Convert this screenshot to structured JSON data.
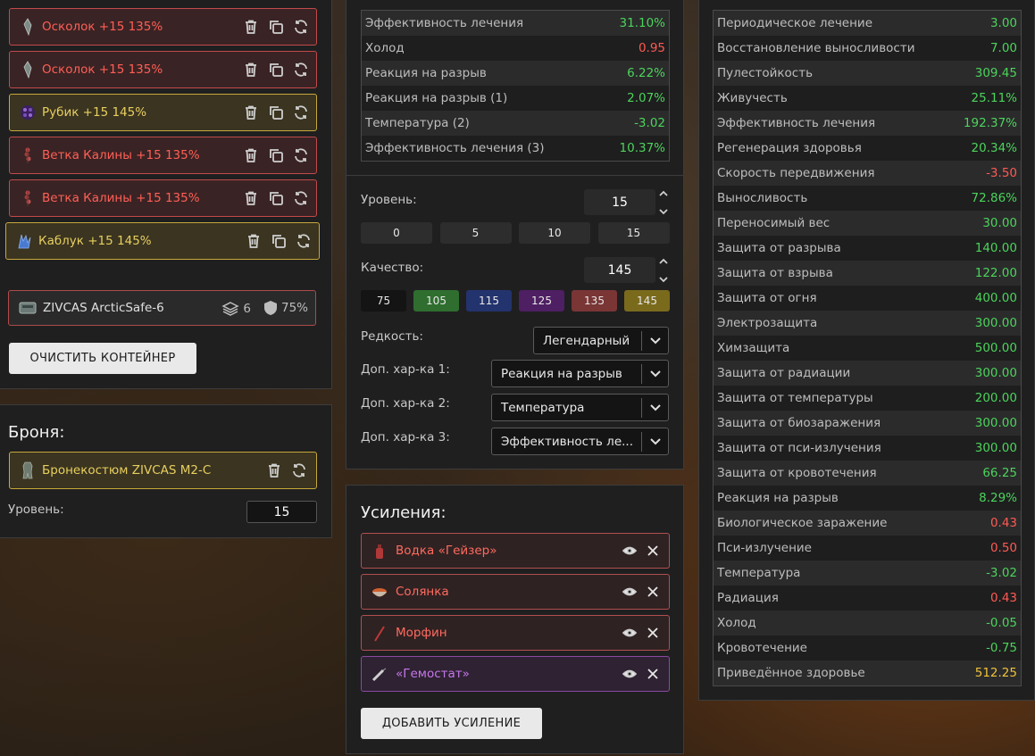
{
  "left": {
    "slots": [
      {
        "name": "Осколок +15 135%",
        "rarity": "red"
      },
      {
        "name": "Осколок +15 135%",
        "rarity": "red"
      },
      {
        "name": "Рубик +15 145%",
        "rarity": "gold"
      },
      {
        "name": "Ветка Калины +15 135%",
        "rarity": "red"
      },
      {
        "name": "Ветка Калины +15 135%",
        "rarity": "red"
      },
      {
        "name": "Каблук +15 145%",
        "rarity": "gold"
      }
    ],
    "container": {
      "name": "ZIVCAS ArcticSafe-6",
      "slots": "6",
      "protection": "75%"
    },
    "clear_button": "ОЧИСТИТЬ КОНТЕЙНЕР"
  },
  "armor": {
    "title": "Броня:",
    "item": "Бронекостюм ZIVCAS M2-C",
    "level_label": "Уровень:",
    "level_value": "15"
  },
  "artifact_stats": [
    {
      "label": "Эффективность лечения",
      "value": "31.10%",
      "tone": "pos"
    },
    {
      "label": "Холод",
      "value": "0.95",
      "tone": "neg"
    },
    {
      "label": "Реакция на разрыв",
      "value": "6.22%",
      "tone": "pos"
    },
    {
      "label": "Реакция на разрыв (1)",
      "value": "2.07%",
      "tone": "pos"
    },
    {
      "label": "Температура (2)",
      "value": "-3.02",
      "tone": "pos"
    },
    {
      "label": "Эффективность лечения (3)",
      "value": "10.37%",
      "tone": "pos"
    }
  ],
  "editor": {
    "level_label": "Уровень:",
    "level_value": "15",
    "level_presets": [
      "0",
      "5",
      "10",
      "15"
    ],
    "quality_label": "Качество:",
    "quality_value": "145",
    "quality_presets": [
      {
        "v": "75",
        "c": "#141414"
      },
      {
        "v": "105",
        "c": "#2f6e2f"
      },
      {
        "v": "115",
        "c": "#23336e"
      },
      {
        "v": "125",
        "c": "#4e1f62"
      },
      {
        "v": "135",
        "c": "#7a3535"
      },
      {
        "v": "145",
        "c": "#7a6a1c"
      }
    ],
    "rarity_label": "Редкость:",
    "rarity_value": "Легендарный",
    "extra1_label": "Доп. хар-ка 1:",
    "extra1_value": "Реакция на разрыв",
    "extra2_label": "Доп. хар-ка 2:",
    "extra2_value": "Температура",
    "extra3_label": "Доп. хар-ка 3:",
    "extra3_value": "Эффективность ле..."
  },
  "boosts": {
    "title": "Усиления:",
    "items": [
      {
        "name": "Водка «Гейзер»",
        "tone": "red"
      },
      {
        "name": "Солянка",
        "tone": "red"
      },
      {
        "name": "Морфин",
        "tone": "red"
      },
      {
        "name": "«Гемостат»",
        "tone": "violet"
      }
    ],
    "add_button": "ДОБАВИТЬ УСИЛЕНИЕ"
  },
  "summary": [
    {
      "label": "Периодическое лечение",
      "value": "3.00",
      "tone": "pos"
    },
    {
      "label": "Восстановление выносливости",
      "value": "7.00",
      "tone": "pos"
    },
    {
      "label": "Пулестойкость",
      "value": "309.45",
      "tone": "pos"
    },
    {
      "label": "Живучесть",
      "value": "25.11%",
      "tone": "pos"
    },
    {
      "label": "Эффективность лечения",
      "value": "192.37%",
      "tone": "pos"
    },
    {
      "label": "Регенерация здоровья",
      "value": "20.34%",
      "tone": "pos"
    },
    {
      "label": "Скорость передвижения",
      "value": "-3.50",
      "tone": "neg"
    },
    {
      "label": "Выносливость",
      "value": "72.86%",
      "tone": "pos"
    },
    {
      "label": "Переносимый вес",
      "value": "30.00",
      "tone": "pos"
    },
    {
      "label": "Защита от разрыва",
      "value": "140.00",
      "tone": "pos"
    },
    {
      "label": "Защита от взрыва",
      "value": "122.00",
      "tone": "pos"
    },
    {
      "label": "Защита от огня",
      "value": "400.00",
      "tone": "pos"
    },
    {
      "label": "Электрозащита",
      "value": "300.00",
      "tone": "pos"
    },
    {
      "label": "Химзащита",
      "value": "500.00",
      "tone": "pos"
    },
    {
      "label": "Защита от радиации",
      "value": "300.00",
      "tone": "pos"
    },
    {
      "label": "Защита от температуры",
      "value": "200.00",
      "tone": "pos"
    },
    {
      "label": "Защита от биозаражения",
      "value": "300.00",
      "tone": "pos"
    },
    {
      "label": "Защита от пси-излучения",
      "value": "300.00",
      "tone": "pos"
    },
    {
      "label": "Защита от кровотечения",
      "value": "66.25",
      "tone": "pos"
    },
    {
      "label": "Реакция на разрыв",
      "value": "8.29%",
      "tone": "pos"
    },
    {
      "label": "Биологическое заражение",
      "value": "0.43",
      "tone": "neg"
    },
    {
      "label": "Пси-излучение",
      "value": "0.50",
      "tone": "neg"
    },
    {
      "label": "Температура",
      "value": "-3.02",
      "tone": "pos"
    },
    {
      "label": "Радиация",
      "value": "0.43",
      "tone": "neg"
    },
    {
      "label": "Холод",
      "value": "-0.05",
      "tone": "pos"
    },
    {
      "label": "Кровотечение",
      "value": "-0.75",
      "tone": "pos"
    },
    {
      "label": "Приведённое здоровье",
      "value": "512.25",
      "tone": "yel"
    }
  ]
}
